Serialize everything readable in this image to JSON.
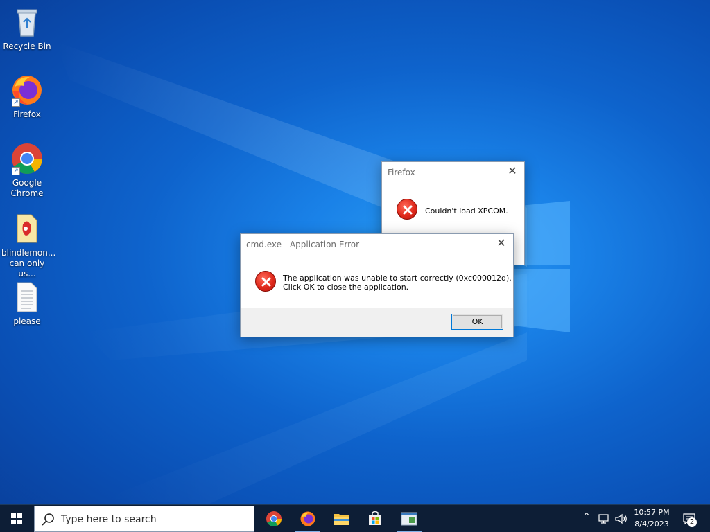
{
  "desktop": {
    "icons": [
      {
        "label": "Recycle Bin",
        "icon": "recycle-bin-icon"
      },
      {
        "label": "Firefox",
        "icon": "firefox-icon"
      },
      {
        "label": "Google Chrome",
        "icon": "chrome-icon"
      },
      {
        "label": "blindlemon... can only us...",
        "icon": "file-icon"
      },
      {
        "label": "please",
        "icon": "text-document-icon"
      }
    ]
  },
  "firefox_dialog": {
    "title": "Firefox",
    "message": "Couldn't load XPCOM.",
    "close_glyph": "✕"
  },
  "cmd_dialog": {
    "title": "cmd.exe - Application Error",
    "message_line1": "The application was unable to start correctly (0xc000012d).",
    "message_line2": "Click OK to close the application.",
    "ok_label": "OK",
    "close_glyph": "✕"
  },
  "taskbar": {
    "search_placeholder": "Type here to search",
    "apps": [
      "chrome-icon",
      "firefox-icon",
      "file-explorer-icon",
      "store-icon",
      "app-window-icon"
    ],
    "clock_time": "10:57 PM",
    "clock_date": "8/4/2023",
    "notification_count": "2",
    "tray_chevron": "^"
  },
  "colors": {
    "desktop_blue": "#0e63cc",
    "taskbar": "#0d1e36",
    "error_red": "#e02a1c",
    "accent": "#0078d7"
  }
}
